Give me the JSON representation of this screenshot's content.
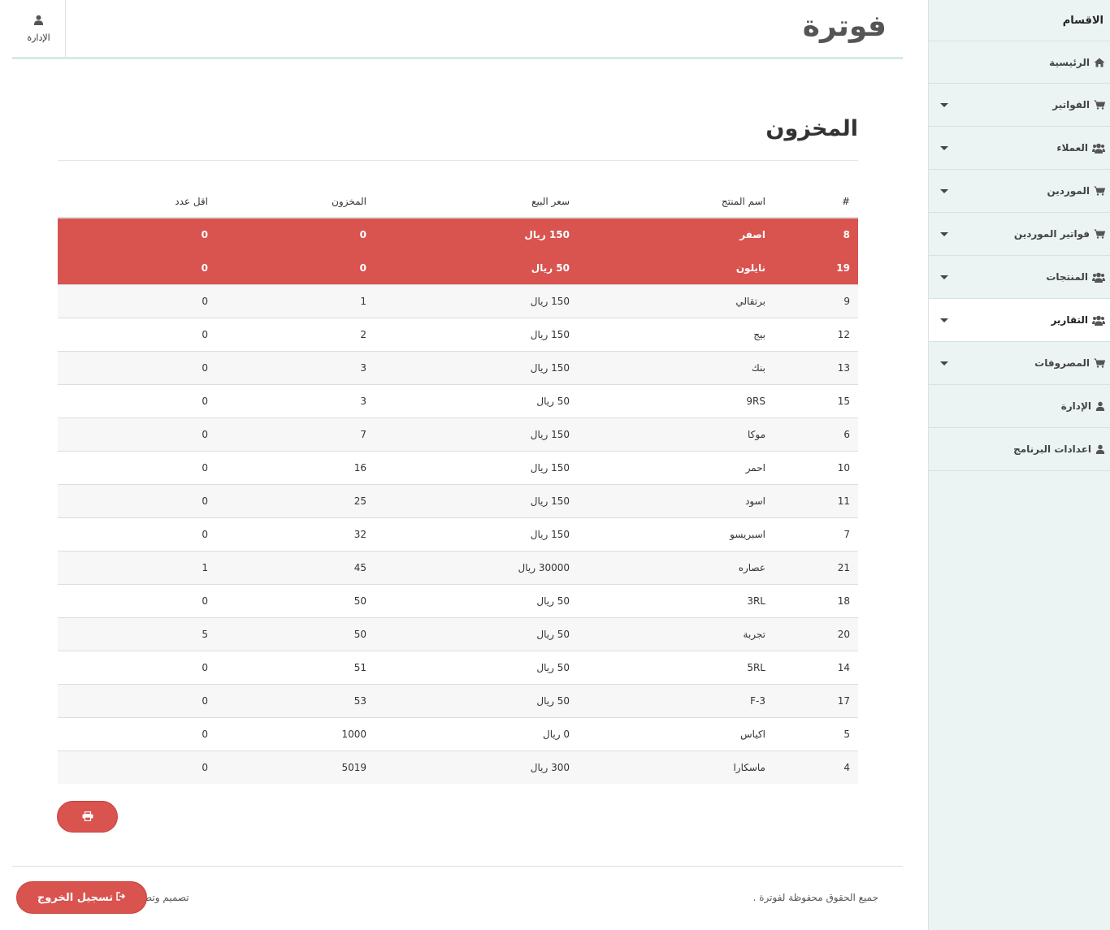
{
  "header": {
    "brand": "فوترة",
    "admin_label": "الإدارة"
  },
  "sidebar": {
    "title": "الاقسام",
    "items": [
      {
        "label": "الرئيسية",
        "icon": "home-icon",
        "has_caret": false,
        "active": false
      },
      {
        "label": "الفواتير",
        "icon": "cart-icon",
        "has_caret": true,
        "active": false
      },
      {
        "label": "العملاء",
        "icon": "users-icon",
        "has_caret": true,
        "active": false
      },
      {
        "label": "الموردين",
        "icon": "cart-icon",
        "has_caret": true,
        "active": false
      },
      {
        "label": "فواتير الموردين",
        "icon": "cart-icon",
        "has_caret": true,
        "active": false
      },
      {
        "label": "المنتجات",
        "icon": "users-icon",
        "has_caret": true,
        "active": false
      },
      {
        "label": "التقارير",
        "icon": "users-icon",
        "has_caret": true,
        "active": true
      },
      {
        "label": "المصروفات",
        "icon": "cart-icon",
        "has_caret": true,
        "active": false
      },
      {
        "label": "الإدارة",
        "icon": "user-icon",
        "has_caret": false,
        "active": false
      },
      {
        "label": "اعدادات البرنامج",
        "icon": "user-icon",
        "has_caret": false,
        "active": false
      }
    ]
  },
  "main": {
    "title": "المخزون",
    "table": {
      "headers": [
        "#",
        "اسم المنتج",
        "سعر البيع",
        "المخزون",
        "اقل عدد"
      ],
      "rows": [
        {
          "id": "8",
          "name": "اصفر",
          "price": "150 ريال",
          "stock": "0",
          "min": "0",
          "status": "danger"
        },
        {
          "id": "19",
          "name": "نايلون",
          "price": "50 ريال",
          "stock": "0",
          "min": "0",
          "status": "danger"
        },
        {
          "id": "9",
          "name": "برتقالي",
          "price": "150 ريال",
          "stock": "1",
          "min": "0",
          "status": "normal"
        },
        {
          "id": "12",
          "name": "بيج",
          "price": "150 ريال",
          "stock": "2",
          "min": "0",
          "status": "normal"
        },
        {
          "id": "13",
          "name": "بنك",
          "price": "150 ريال",
          "stock": "3",
          "min": "0",
          "status": "normal"
        },
        {
          "id": "15",
          "name": "9RS",
          "price": "50 ريال",
          "stock": "3",
          "min": "0",
          "status": "normal"
        },
        {
          "id": "6",
          "name": "موكا",
          "price": "150 ريال",
          "stock": "7",
          "min": "0",
          "status": "normal"
        },
        {
          "id": "10",
          "name": "احمر",
          "price": "150 ريال",
          "stock": "16",
          "min": "0",
          "status": "normal"
        },
        {
          "id": "11",
          "name": "اسود",
          "price": "150 ريال",
          "stock": "25",
          "min": "0",
          "status": "normal"
        },
        {
          "id": "7",
          "name": "اسبريسو",
          "price": "150 ريال",
          "stock": "32",
          "min": "0",
          "status": "normal"
        },
        {
          "id": "21",
          "name": "عصاره",
          "price": "30000 ريال",
          "stock": "45",
          "min": "1",
          "status": "normal"
        },
        {
          "id": "18",
          "name": "3RL",
          "price": "50 ريال",
          "stock": "50",
          "min": "0",
          "status": "normal"
        },
        {
          "id": "20",
          "name": "تجربة",
          "price": "50 ريال",
          "stock": "50",
          "min": "5",
          "status": "normal"
        },
        {
          "id": "14",
          "name": "5RL",
          "price": "50 ريال",
          "stock": "51",
          "min": "0",
          "status": "normal"
        },
        {
          "id": "17",
          "name": "F-3",
          "price": "50 ريال",
          "stock": "53",
          "min": "0",
          "status": "normal"
        },
        {
          "id": "5",
          "name": "اكياس",
          "price": "0 ريال",
          "stock": "1000",
          "min": "0",
          "status": "normal"
        },
        {
          "id": "4",
          "name": "ماسكارا",
          "price": "300 ريال",
          "stock": "5019",
          "min": "0",
          "status": "normal"
        }
      ]
    }
  },
  "footer": {
    "copyright": "جميع الحقوق محفوظة لفوترة .",
    "design": "تصميم وتط",
    "logout_label": "تسجيل الخروج"
  },
  "colors": {
    "danger": "#d9534f",
    "sidebar_bg": "#ebf4f3",
    "header_rule": "#d7eae7"
  }
}
